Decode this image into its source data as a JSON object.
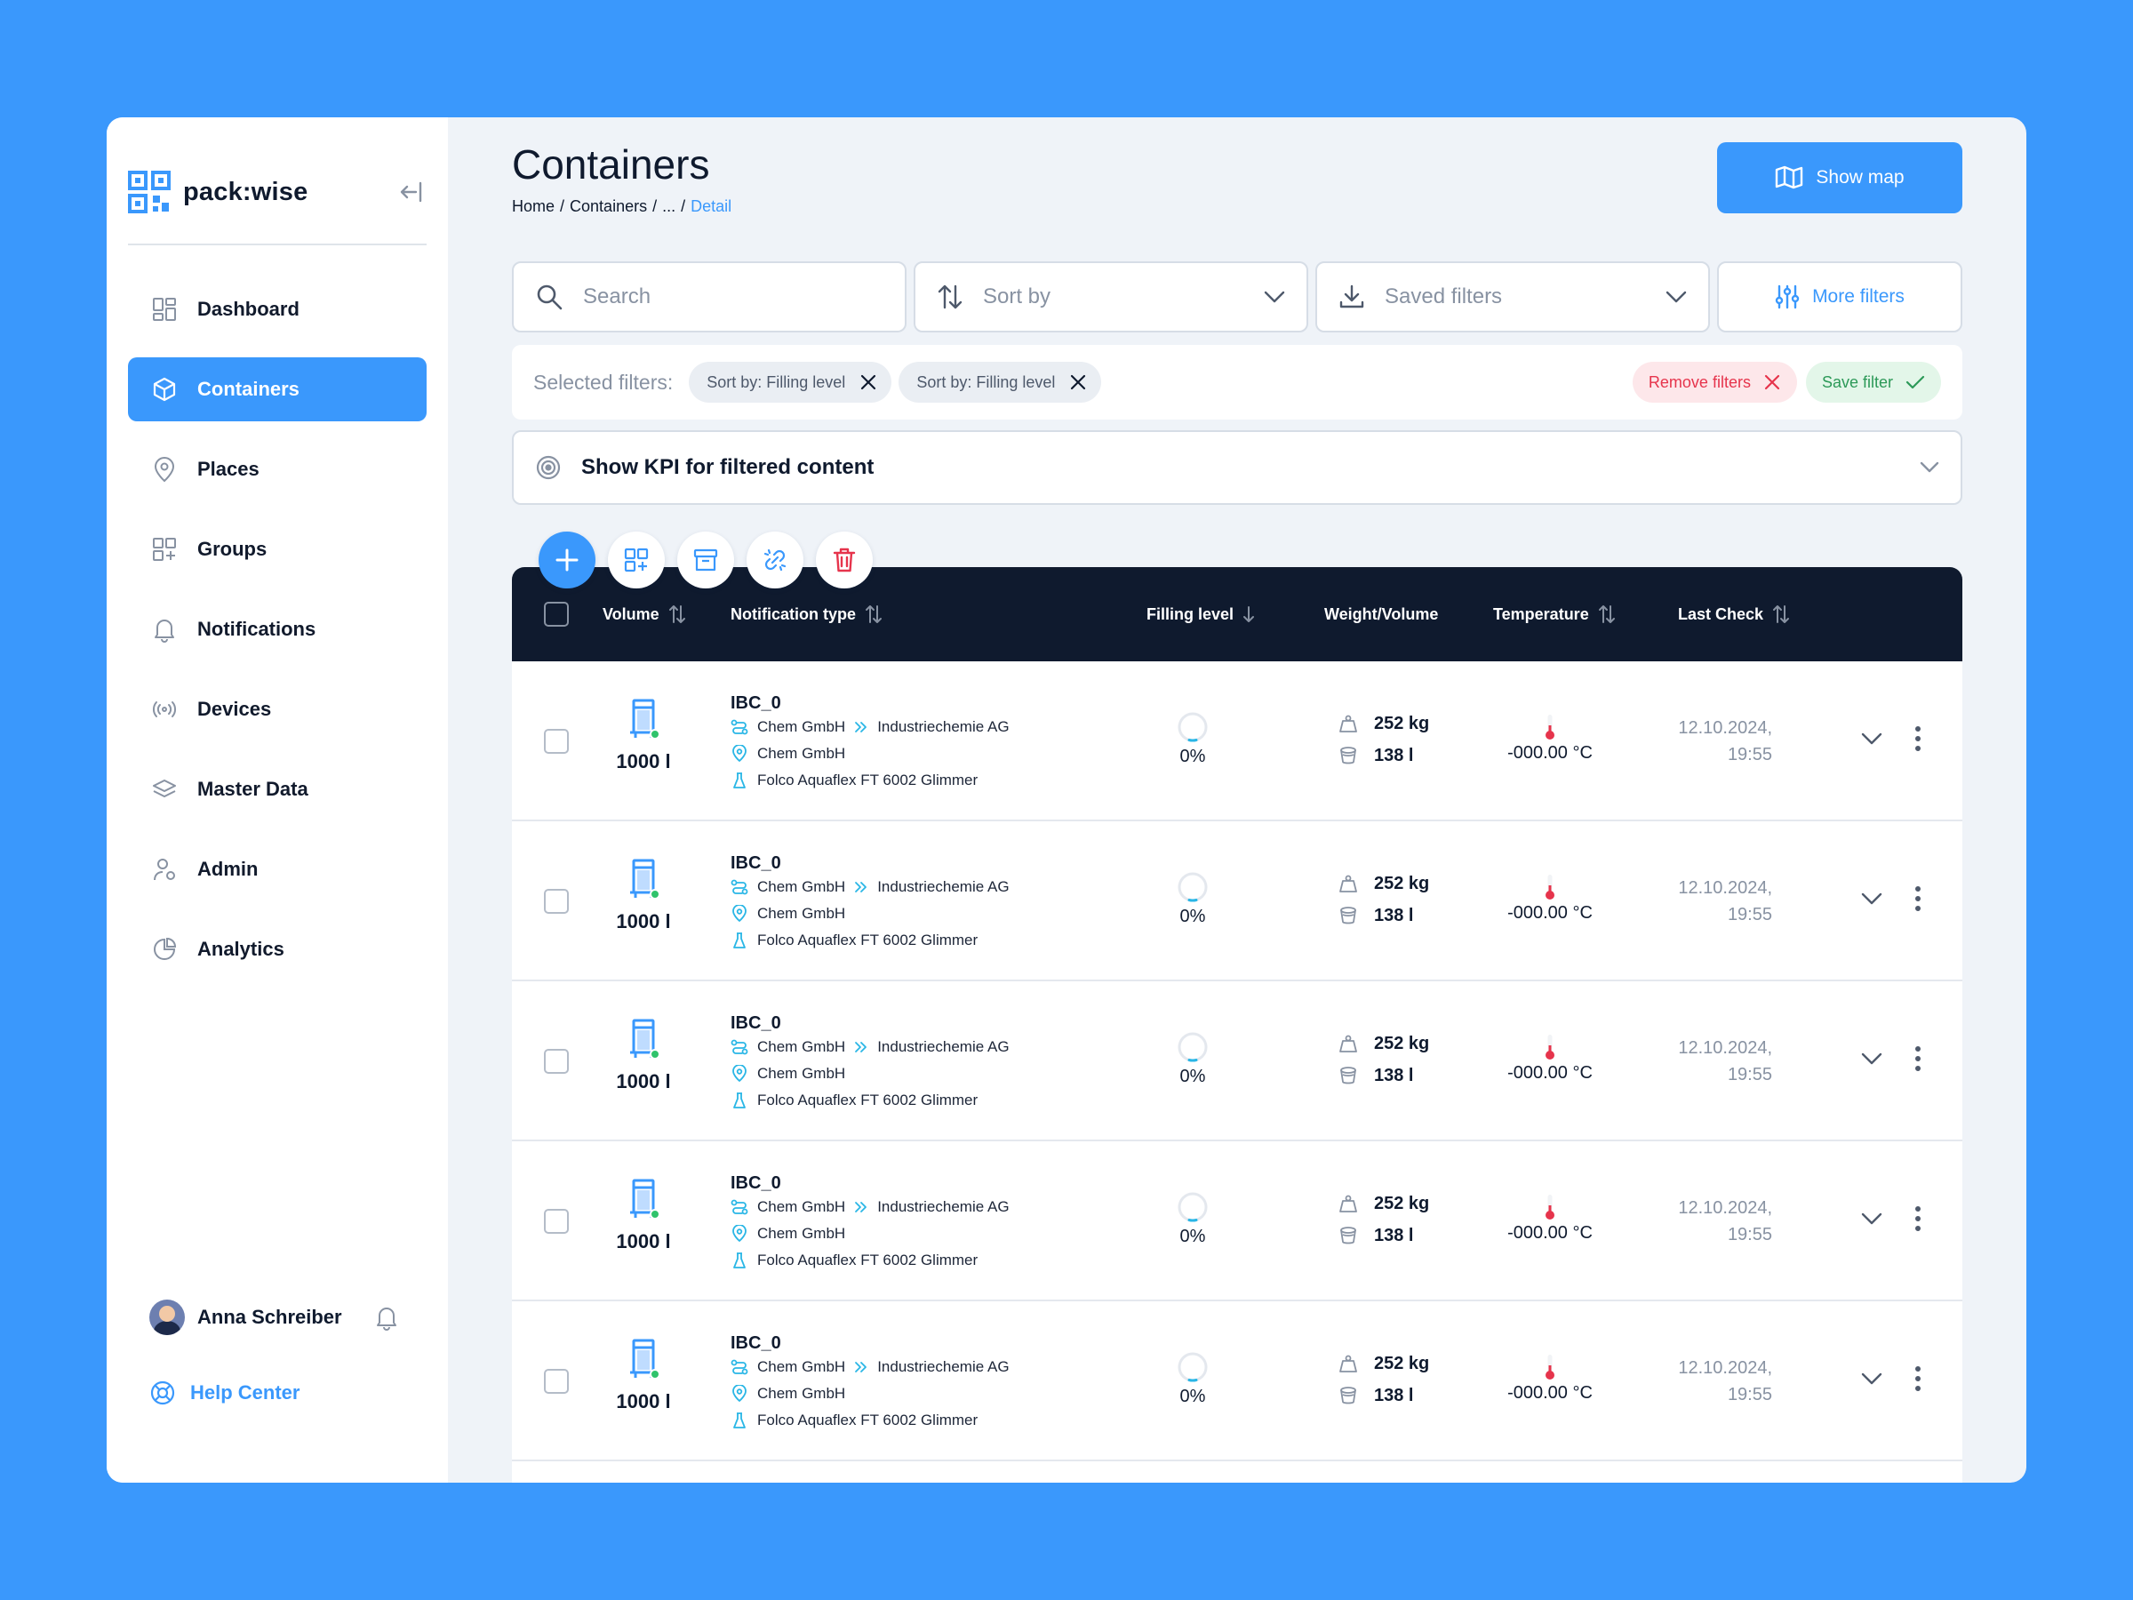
{
  "brand": {
    "name": "pack:wise"
  },
  "sidebar": {
    "items": [
      {
        "label": "Dashboard",
        "icon": "dashboard-icon"
      },
      {
        "label": "Containers",
        "icon": "cube-icon",
        "active": true
      },
      {
        "label": "Places",
        "icon": "location-pin-icon"
      },
      {
        "label": "Groups",
        "icon": "groups-icon"
      },
      {
        "label": "Notifications",
        "icon": "bell-icon"
      },
      {
        "label": "Devices",
        "icon": "signal-icon"
      },
      {
        "label": "Master Data",
        "icon": "layers-icon"
      },
      {
        "label": "Admin",
        "icon": "user-gear-icon"
      },
      {
        "label": "Analytics",
        "icon": "pie-chart-icon"
      }
    ],
    "user_name": "Anna Schreiber",
    "help_label": "Help Center"
  },
  "page": {
    "title": "Containers",
    "breadcrumb": [
      "Home",
      "/",
      "Containers",
      "/",
      "...",
      "/",
      "Detail"
    ],
    "show_map_label": "Show map"
  },
  "filters": {
    "search_placeholder": "Search",
    "sort_label": "Sort by",
    "saved_label": "Saved filters",
    "more_label": "More filters",
    "selected_label": "Selected filters:",
    "chips": [
      "Sort by: Filling level",
      "Sort by: Filling level"
    ],
    "remove_label": "Remove filters",
    "save_label": "Save filter"
  },
  "kpi": {
    "label": "Show KPI for filtered content"
  },
  "table": {
    "columns": {
      "volume": "Volume",
      "notification": "Notification type",
      "filling": "Filling level",
      "weight": "Weight/Volume",
      "temperature": "Temperature",
      "last_check": "Last Check"
    },
    "rows": [
      {
        "volume": "1000 l",
        "name": "IBC_0",
        "from": "Chem GmbH",
        "to": "Industriechemie AG",
        "place": "Chem GmbH",
        "product": "Folco Aquaflex FT 6002 Glimmer",
        "filling": "0%",
        "weight": "252 kg",
        "vol": "138 l",
        "temp": "-000.00 °C",
        "date": "12.10.2024,",
        "time": "19:55"
      },
      {
        "volume": "1000 l",
        "name": "IBC_0",
        "from": "Chem GmbH",
        "to": "Industriechemie AG",
        "place": "Chem GmbH",
        "product": "Folco Aquaflex FT 6002 Glimmer",
        "filling": "0%",
        "weight": "252 kg",
        "vol": "138 l",
        "temp": "-000.00 °C",
        "date": "12.10.2024,",
        "time": "19:55"
      },
      {
        "volume": "1000 l",
        "name": "IBC_0",
        "from": "Chem GmbH",
        "to": "Industriechemie AG",
        "place": "Chem GmbH",
        "product": "Folco Aquaflex FT 6002 Glimmer",
        "filling": "0%",
        "weight": "252 kg",
        "vol": "138 l",
        "temp": "-000.00 °C",
        "date": "12.10.2024,",
        "time": "19:55"
      },
      {
        "volume": "1000 l",
        "name": "IBC_0",
        "from": "Chem GmbH",
        "to": "Industriechemie AG",
        "place": "Chem GmbH",
        "product": "Folco Aquaflex FT 6002 Glimmer",
        "filling": "0%",
        "weight": "252 kg",
        "vol": "138 l",
        "temp": "-000.00 °C",
        "date": "12.10.2024,",
        "time": "19:55"
      },
      {
        "volume": "1000 l",
        "name": "IBC_0",
        "from": "Chem GmbH",
        "to": "Industriechemie AG",
        "place": "Chem GmbH",
        "product": "Folco Aquaflex FT 6002 Glimmer",
        "filling": "0%",
        "weight": "252 kg",
        "vol": "138 l",
        "temp": "-000.00 °C",
        "date": "12.10.2024,",
        "time": "19:55"
      }
    ]
  },
  "colors": {
    "accent": "#3a98fc",
    "dark": "#0f1a2e",
    "danger": "#e6344c",
    "success": "#2c9958"
  }
}
